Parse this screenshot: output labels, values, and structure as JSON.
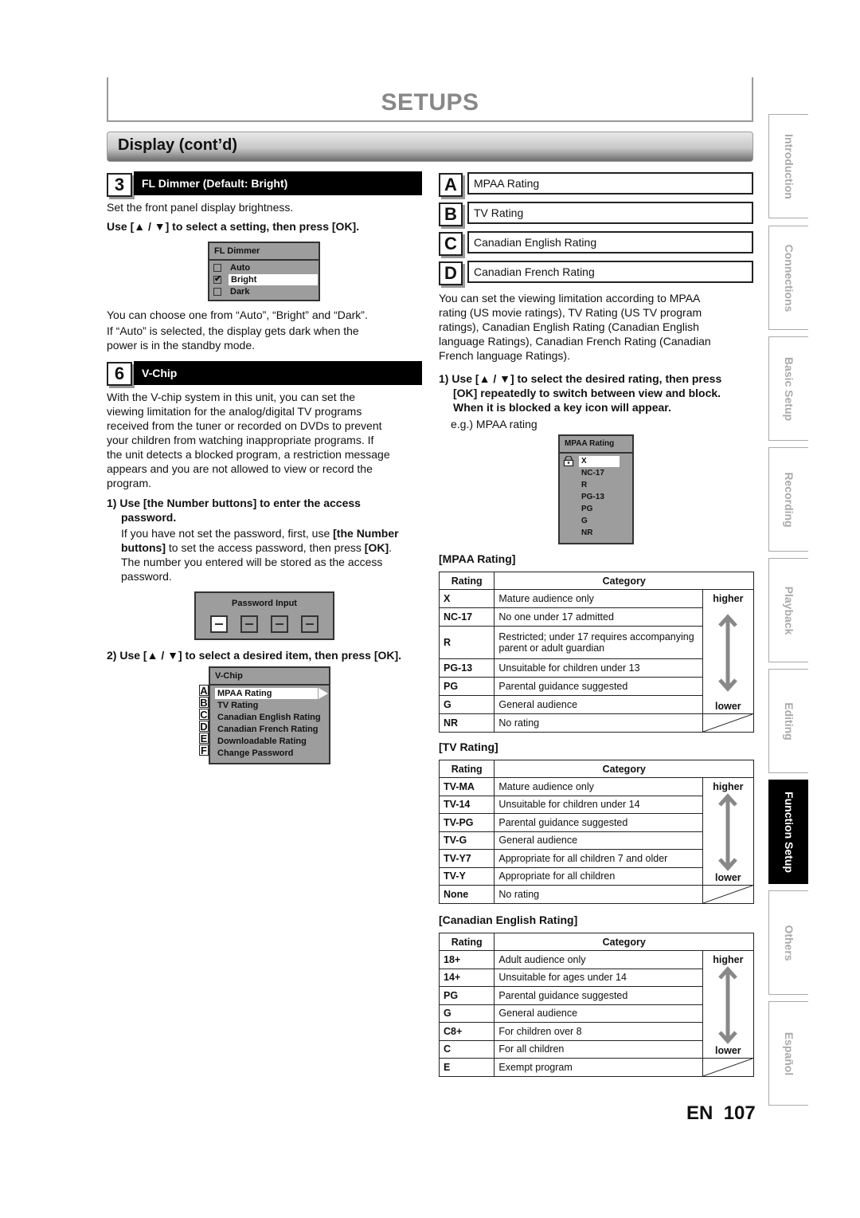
{
  "page": {
    "chapter_title": "SETUPS",
    "section_title": "Display (cont’d)",
    "language": "EN",
    "page_number": "107"
  },
  "step3": {
    "number": "3",
    "title": "FL Dimmer (Default: Bright)",
    "intro": "Set the front panel display brightness.",
    "instruction": "Use [▲ / ▼] to select a setting, then press [OK].",
    "menu": {
      "title": "FL Dimmer",
      "options": [
        {
          "label": "Auto",
          "checked": false
        },
        {
          "label": "Bright",
          "checked": true
        },
        {
          "label": "Dark",
          "checked": false
        }
      ],
      "selected": "Bright"
    },
    "note1": "You can choose one from “Auto”, “Bright” and “Dark”.",
    "note2_line1": "If “Auto” is selected, the display gets dark when the",
    "note2_line2": "power is in the standby mode."
  },
  "step6": {
    "number": "6",
    "title": "V-Chip",
    "body_lines": [
      "With the V-chip system in this unit, you can set the",
      "viewing limitation for the analog/digital TV programs",
      "received from the tuner or recorded on DVDs to prevent",
      "your children from watching inappropriate programs. If",
      "the unit detects a blocked program, a restriction message",
      "appears and you are not allowed to view or record the",
      "program."
    ],
    "sub1_title_line1": "1) Use [the Number buttons] to enter the access",
    "sub1_title_line2": "password.",
    "sub1_body_line1_a": "If you have not set the password, first, use ",
    "sub1_body_line1_b": "[the Number",
    "sub1_body_line2_a": "buttons]",
    "sub1_body_line2_b": " to set the access password, then press ",
    "sub1_body_line2_c": "[OK]",
    "sub1_body_line2_d": ".",
    "sub1_body_line3": "The number you entered will be stored as the access",
    "sub1_body_line4": "password.",
    "password_menu_title": "Password Input",
    "sub2_title": "2) Use [▲ / ▼] to select a desired item, then press [OK].",
    "vchip_menu": {
      "title": "V-Chip",
      "items": [
        {
          "letter": "A",
          "label": "MPAA Rating"
        },
        {
          "letter": "B",
          "label": "TV Rating"
        },
        {
          "letter": "C",
          "label": "Canadian English Rating"
        },
        {
          "letter": "D",
          "label": "Canadian French Rating"
        },
        {
          "letter": "E",
          "label": "Downloadable Rating"
        },
        {
          "letter": "F",
          "label": "Change Password"
        }
      ],
      "selected": "MPAA Rating"
    }
  },
  "right": {
    "labels": [
      {
        "letter": "A",
        "label": "MPAA Rating"
      },
      {
        "letter": "B",
        "label": "TV Rating"
      },
      {
        "letter": "C",
        "label": "Canadian English Rating"
      },
      {
        "letter": "D",
        "label": "Canadian French Rating"
      }
    ],
    "body_lines": [
      "You can set the viewing limitation according to MPAA",
      "rating (US movie ratings), TV Rating (US TV program",
      "ratings), Canadian English Rating (Canadian English",
      "language Ratings), Canadian French Rating (Canadian",
      "French language Ratings)."
    ],
    "step1_lines": [
      "1) Use [▲ / ▼] to select the desired rating, then press",
      "[OK] repeatedly to switch between view and block.",
      "When it is blocked a key icon will appear."
    ],
    "example_label": "e.g.) MPAA rating",
    "mpaa_menu": {
      "title": "MPAA Rating",
      "items": [
        "X",
        "NC-17",
        "R",
        "PG-13",
        "PG",
        "G",
        "NR"
      ],
      "selected": "X",
      "locked": "X"
    }
  },
  "tables": {
    "header_rating": "Rating",
    "header_category": "Category",
    "higher_label": "higher",
    "lower_label": "lower",
    "mpaa": {
      "title": "[MPAA Rating]",
      "rows": [
        {
          "rating": "X",
          "category": "Mature audience only"
        },
        {
          "rating": "NC-17",
          "category": "No one under 17 admitted"
        },
        {
          "rating": "R",
          "category": "Restricted; under 17 requires accompanying parent or adult guardian"
        },
        {
          "rating": "PG-13",
          "category": "Unsuitable for children under 13"
        },
        {
          "rating": "PG",
          "category": "Parental guidance suggested"
        },
        {
          "rating": "G",
          "category": "General audience"
        },
        {
          "rating": "NR",
          "category": "No rating"
        }
      ]
    },
    "tv": {
      "title": "[TV Rating]",
      "rows": [
        {
          "rating": "TV-MA",
          "category": "Mature audience only"
        },
        {
          "rating": "TV-14",
          "category": "Unsuitable for children under 14"
        },
        {
          "rating": "TV-PG",
          "category": "Parental guidance suggested"
        },
        {
          "rating": "TV-G",
          "category": "General audience"
        },
        {
          "rating": "TV-Y7",
          "category": "Appropriate for all children 7 and older"
        },
        {
          "rating": "TV-Y",
          "category": "Appropriate for all children"
        },
        {
          "rating": "None",
          "category": "No rating"
        }
      ]
    },
    "canadian_english": {
      "title": "[Canadian English Rating]",
      "rows": [
        {
          "rating": "18+",
          "category": "Adult audience only"
        },
        {
          "rating": "14+",
          "category": "Unsuitable for ages under 14"
        },
        {
          "rating": "PG",
          "category": "Parental guidance suggested"
        },
        {
          "rating": "G",
          "category": "General audience"
        },
        {
          "rating": "C8+",
          "category": "For children over 8"
        },
        {
          "rating": "C",
          "category": "For all children"
        },
        {
          "rating": "E",
          "category": "Exempt program"
        }
      ]
    }
  },
  "side_tabs": [
    {
      "label": "Introduction",
      "active": false
    },
    {
      "label": "Connections",
      "active": false
    },
    {
      "label": "Basic Setup",
      "active": false
    },
    {
      "label": "Recording",
      "active": false
    },
    {
      "label": "Playback",
      "active": false
    },
    {
      "label": "Editing",
      "active": false
    },
    {
      "label": "Function Setup",
      "active": true
    },
    {
      "label": "Others",
      "active": false
    },
    {
      "label": "Español",
      "active": false
    }
  ]
}
